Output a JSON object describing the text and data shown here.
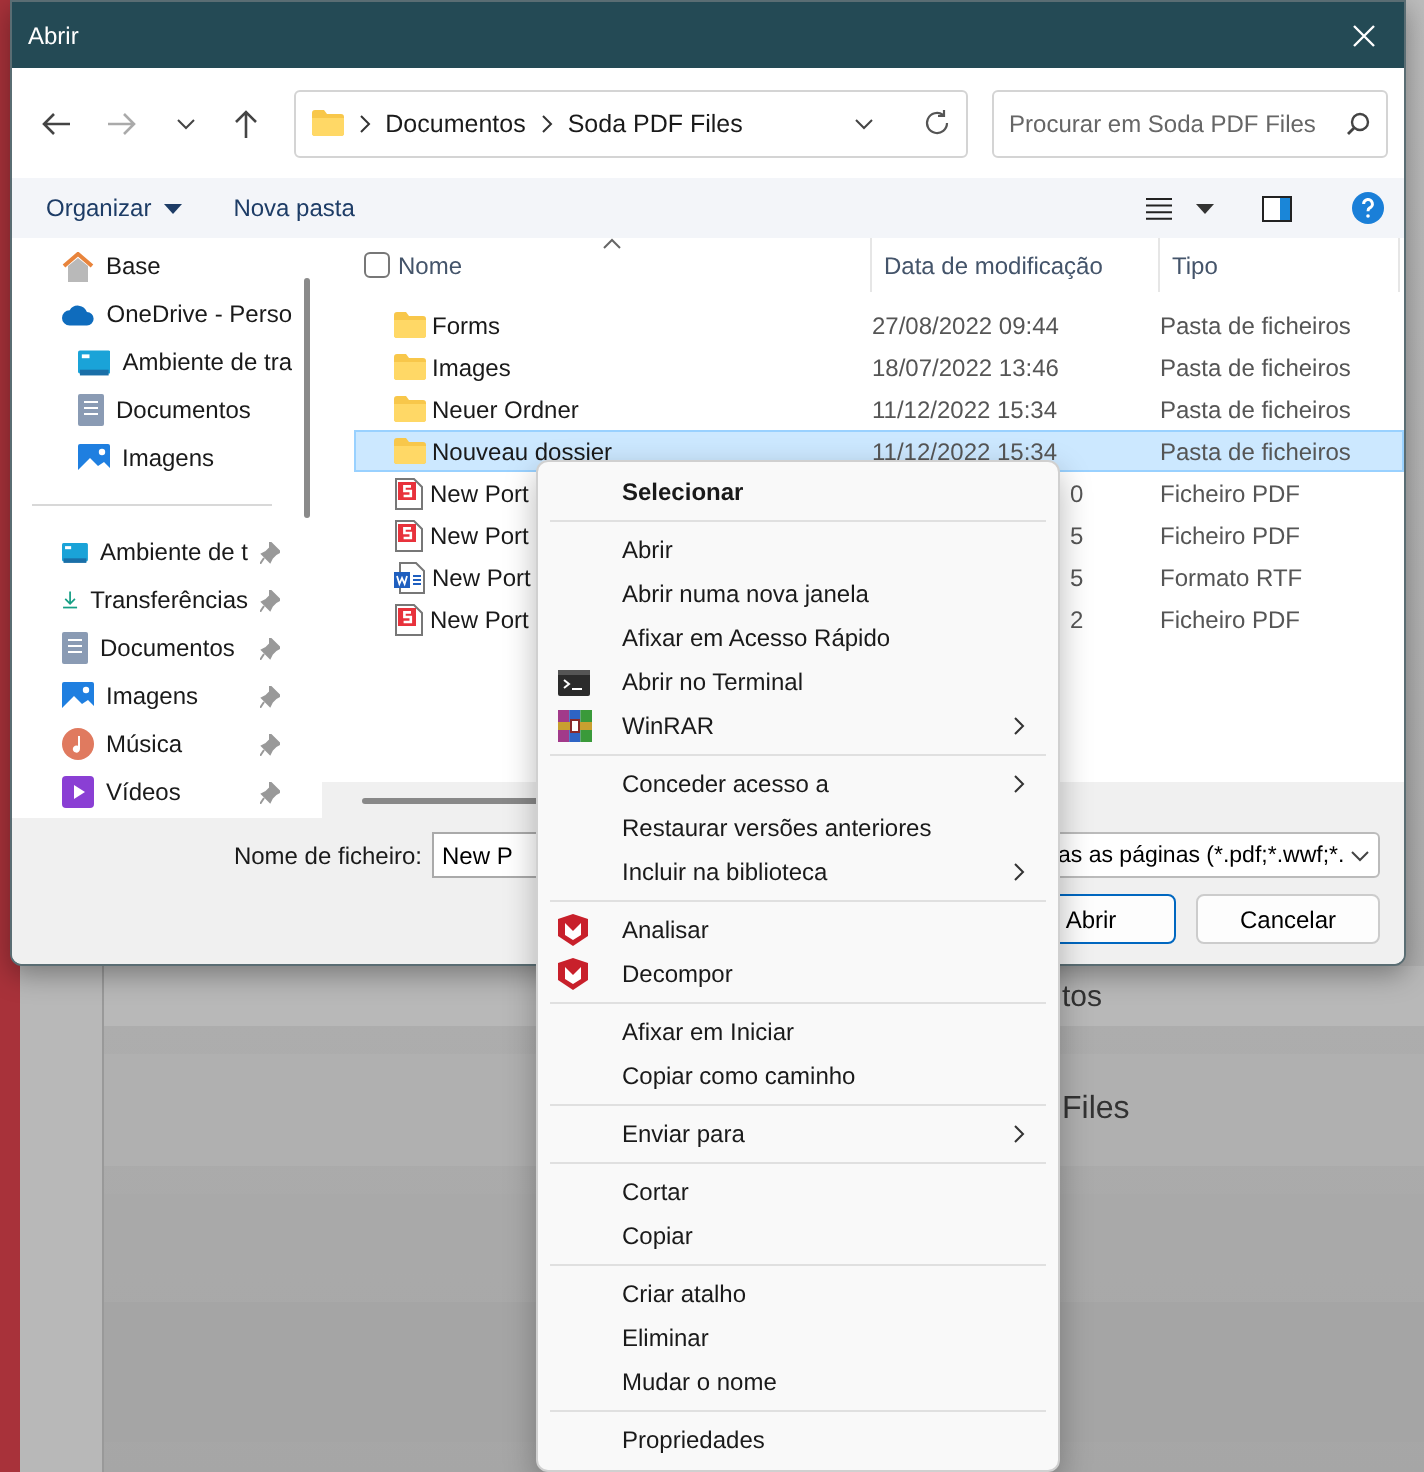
{
  "background_app": {
    "texts": [
      "tos",
      "Files"
    ]
  },
  "window": {
    "title": "Abrir"
  },
  "address_bar": {
    "path": [
      "Documentos",
      "Soda PDF Files"
    ]
  },
  "search": {
    "placeholder": "Procurar em Soda PDF Files"
  },
  "command_bar": {
    "items": [
      "Organizar",
      "Nova pasta"
    ]
  },
  "sidebar": {
    "items": [
      {
        "label": "Base",
        "kind": "home",
        "pinned": false
      },
      {
        "label": "OneDrive - Perso",
        "kind": "cloud",
        "pinned": false,
        "children": [
          {
            "label": "Ambiente de tra",
            "kind": "desktop",
            "pinned": false
          },
          {
            "label": "Documentos",
            "kind": "document",
            "pinned": false
          },
          {
            "label": "Imagens",
            "kind": "pictures",
            "pinned": false
          }
        ]
      }
    ],
    "quick_access": [
      {
        "label": "Ambiente de t",
        "kind": "desktop",
        "pinned": true
      },
      {
        "label": "Transferências",
        "kind": "download",
        "pinned": true
      },
      {
        "label": "Documentos",
        "kind": "document",
        "pinned": true
      },
      {
        "label": "Imagens",
        "kind": "pictures",
        "pinned": true
      },
      {
        "label": "Música",
        "kind": "music",
        "pinned": true
      },
      {
        "label": "Vídeos",
        "kind": "video",
        "pinned": true
      }
    ]
  },
  "table": {
    "select_all": {
      "checked": false
    },
    "columns": [
      "Nome",
      "Data de modificação",
      "Tipo"
    ],
    "rows": [
      {
        "kind": "folder",
        "name": "Forms",
        "date": "27/08/2022 09:44",
        "type": "Pasta de ficheiros",
        "selected": false,
        "date_cut": false
      },
      {
        "kind": "folder",
        "name": "Images",
        "date": "18/07/2022 13:46",
        "type": "Pasta de ficheiros",
        "selected": false,
        "date_cut": false
      },
      {
        "kind": "folder",
        "name": "Neuer Ordner",
        "date": "11/12/2022 15:34",
        "type": "Pasta de ficheiros",
        "selected": false,
        "date_cut": false
      },
      {
        "kind": "folder",
        "name": "Nouveau dossier",
        "date": "11/12/2022 15:34",
        "type": "Pasta de ficheiros",
        "selected": true,
        "date_cut": false
      },
      {
        "kind": "pdf",
        "name": "New Port",
        "date": "0",
        "type": "Ficheiro PDF",
        "selected": false,
        "date_cut": true
      },
      {
        "kind": "pdf",
        "name": "New Port",
        "date": "5",
        "type": "Ficheiro PDF",
        "selected": false,
        "date_cut": true
      },
      {
        "kind": "rtf",
        "name": "New Port",
        "date": "5",
        "type": "Formato RTF",
        "selected": false,
        "date_cut": true
      },
      {
        "kind": "pdf",
        "name": "New Port",
        "date": "2",
        "type": "Ficheiro PDF",
        "selected": false,
        "date_cut": true
      }
    ]
  },
  "footer": {
    "filename_label": "Nome de ficheiro:",
    "filename_value": "New P",
    "filter": "as as páginas (*.pdf;*.wwf;*.",
    "buttons": [
      {
        "label": "Abrir",
        "kind": "primary"
      },
      {
        "label": "Cancelar",
        "kind": "secondary"
      }
    ]
  },
  "context_menu": {
    "groups": [
      [
        {
          "label": "Selecionar",
          "kind": "plain",
          "default": true,
          "submenu": false
        }
      ],
      [
        {
          "label": "Abrir",
          "kind": "plain",
          "default": false,
          "submenu": false
        },
        {
          "label": "Abrir numa nova janela",
          "kind": "plain",
          "default": false,
          "submenu": false
        },
        {
          "label": "Afixar em Acesso Rápido",
          "kind": "plain",
          "default": false,
          "submenu": false
        },
        {
          "label": "Abrir no Terminal",
          "kind": "terminal",
          "default": false,
          "submenu": false
        },
        {
          "label": "WinRAR",
          "kind": "archive",
          "default": false,
          "submenu": true
        }
      ],
      [
        {
          "label": "Conceder acesso a",
          "kind": "plain",
          "default": false,
          "submenu": true
        },
        {
          "label": "Restaurar versões anteriores",
          "kind": "plain",
          "default": false,
          "submenu": false
        },
        {
          "label": "Incluir na biblioteca",
          "kind": "plain",
          "default": false,
          "submenu": true
        }
      ],
      [
        {
          "label": "Analisar",
          "kind": "shield",
          "default": false,
          "submenu": false
        },
        {
          "label": "Decompor",
          "kind": "shield",
          "default": false,
          "submenu": false
        }
      ],
      [
        {
          "label": "Afixar em Iniciar",
          "kind": "plain",
          "default": false,
          "submenu": false
        },
        {
          "label": "Copiar como caminho",
          "kind": "plain",
          "default": false,
          "submenu": false
        }
      ],
      [
        {
          "label": "Enviar para",
          "kind": "plain",
          "default": false,
          "submenu": true
        }
      ],
      [
        {
          "label": "Cortar",
          "kind": "plain",
          "default": false,
          "submenu": false
        },
        {
          "label": "Copiar",
          "kind": "plain",
          "default": false,
          "submenu": false
        }
      ],
      [
        {
          "label": "Criar atalho",
          "kind": "plain",
          "default": false,
          "submenu": false
        },
        {
          "label": "Eliminar",
          "kind": "plain",
          "default": false,
          "submenu": false
        },
        {
          "label": "Mudar o nome",
          "kind": "plain",
          "default": false,
          "submenu": false
        }
      ],
      [
        {
          "label": "Propriedades",
          "kind": "plain",
          "default": false,
          "submenu": false
        }
      ]
    ]
  }
}
